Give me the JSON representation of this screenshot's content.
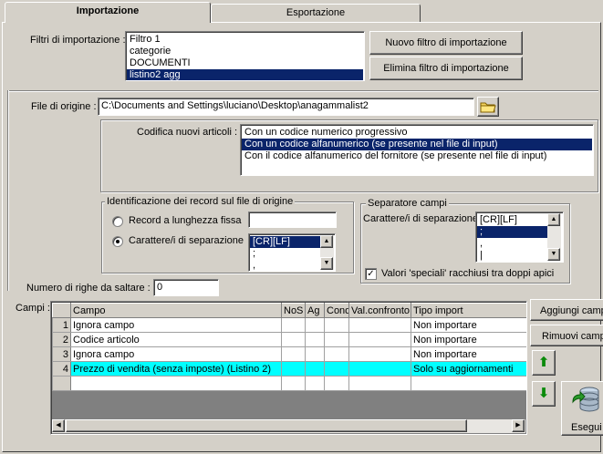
{
  "tabs": [
    {
      "label": "Importazione",
      "active": true
    },
    {
      "label": "Esportazione",
      "active": false
    }
  ],
  "filters": {
    "label": "Filtri di importazione :",
    "items": [
      "Filtro 1",
      "categorie",
      "DOCUMENTI",
      "listino2 agg"
    ],
    "selected_index": 3,
    "new_button": "Nuovo filtro di importazione",
    "delete_button": "Elimina filtro di importazione"
  },
  "source_file": {
    "label": "File di origine :",
    "value": "C:\\Documents and Settings\\luciano\\Desktop\\anagammalist2",
    "browse_icon": "folder-icon"
  },
  "encoding": {
    "label": "Codifica nuovi articoli :",
    "options": [
      "Con un codice numerico progressivo",
      "Con un codice alfanumerico (se presente nel file di input)",
      "Con il codice alfanumerico del fornitore (se presente nel file di input)"
    ],
    "selected_index": 1
  },
  "record_id": {
    "title": "Identificazione dei record sul file di origine",
    "fixed_label": "Record a lunghezza fissa",
    "fixed_value": "",
    "sep_label": "Carattere/i di separazione",
    "sep_options": [
      "[CR][LF]",
      ";",
      ","
    ],
    "sep_selected_index": 0,
    "selected": "separator"
  },
  "field_separator": {
    "title": "Separatore campi",
    "label": "Carattere/i di separazione",
    "options": [
      "[CR][LF]",
      ";",
      ",",
      "|"
    ],
    "selected_index": 1,
    "special_label": "Valori 'speciali' racchiusi tra doppi apici",
    "special_checked": true
  },
  "skip_rows": {
    "label": "Numero di righe da saltare  :",
    "value": "0"
  },
  "fields": {
    "label": "Campi :",
    "columns": [
      "Campo",
      "NoS",
      "Ag",
      "Cond",
      "Val.confronto",
      "Tipo import"
    ],
    "rows": [
      {
        "num": "1",
        "campo": "Ignora campo",
        "tipo": "Non importare"
      },
      {
        "num": "2",
        "campo": "Codice articolo",
        "tipo": "Non importare"
      },
      {
        "num": "3",
        "campo": "Ignora campo",
        "tipo": "Non importare"
      },
      {
        "num": "4",
        "campo": "Prezzo di vendita (senza imposte) (Listino 2)",
        "tipo": "Solo su aggiornamenti"
      }
    ],
    "highlighted_index": 3,
    "add_button": "Aggiungi campo",
    "remove_button": "Rimuovi campo",
    "up_icon": "arrow-up-icon",
    "down_icon": "arrow-down-icon",
    "execute_button": "Esegui",
    "execute_icon": "database-icon"
  },
  "colors": {
    "face": "#d4d0c8",
    "selection": "#0a246a",
    "highlight_row": "#00ffff"
  }
}
